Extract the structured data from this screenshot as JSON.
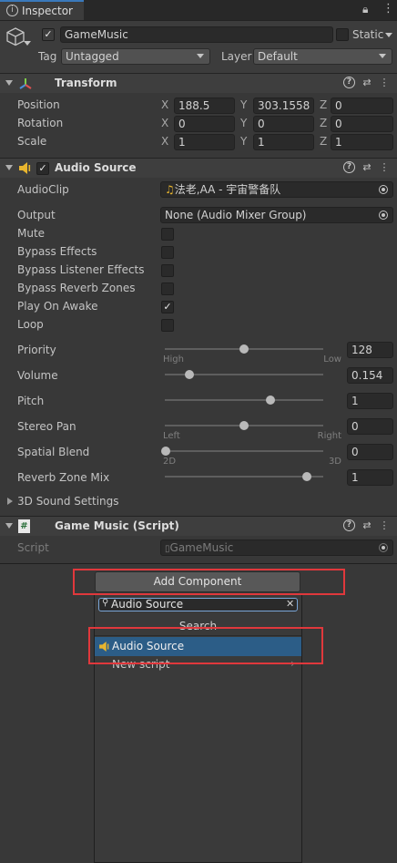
{
  "tab": {
    "title": "Inspector"
  },
  "object": {
    "name": "GameMusic",
    "static_label": "Static",
    "tag_label": "Tag",
    "tag_value": "Untagged",
    "layer_label": "Layer",
    "layer_value": "Default"
  },
  "transform": {
    "title": "Transform",
    "rows": [
      {
        "label": "Position",
        "x": "188.5",
        "y": "303.1558",
        "z": "0"
      },
      {
        "label": "Rotation",
        "x": "0",
        "y": "0",
        "z": "0"
      },
      {
        "label": "Scale",
        "x": "1",
        "y": "1",
        "z": "1"
      }
    ],
    "axis": {
      "x": "X",
      "y": "Y",
      "z": "Z"
    }
  },
  "audio": {
    "title": "Audio Source",
    "clip_label": "AudioClip",
    "clip_value": "法老,AA - 宇宙警备队",
    "output_label": "Output",
    "output_value": "None (Audio Mixer Group)",
    "toggles": [
      {
        "label": "Mute",
        "checked": false
      },
      {
        "label": "Bypass Effects",
        "checked": false
      },
      {
        "label": "Bypass Listener Effects",
        "checked": false
      },
      {
        "label": "Bypass Reverb Zones",
        "checked": false
      },
      {
        "label": "Play On Awake",
        "checked": true
      },
      {
        "label": "Loop",
        "checked": false
      }
    ],
    "sliders": [
      {
        "label": "Priority",
        "value": "128",
        "level": 0.5,
        "left": "High",
        "right": "Low"
      },
      {
        "label": "Volume",
        "value": "0.154",
        "level": 0.154
      },
      {
        "label": "Pitch",
        "value": "1",
        "level": 0.67
      },
      {
        "label": "Stereo Pan",
        "value": "0",
        "level": 0.5,
        "left": "Left",
        "right": "Right"
      },
      {
        "label": "Spatial Blend",
        "value": "0",
        "level": 0.0,
        "left": "2D",
        "right": "3D"
      },
      {
        "label": "Reverb Zone Mix",
        "value": "1",
        "level": 0.9
      }
    ],
    "sound_settings_label": "3D Sound Settings"
  },
  "script": {
    "title": "Game Music (Script)",
    "field_label": "Script",
    "field_value": "GameMusic"
  },
  "add_component": {
    "button_label": "Add Component",
    "search_value": "Audio Source",
    "section_label": "Search",
    "result_label": "Audio Source",
    "new_script_label": "New script"
  },
  "colors": {
    "accent": "#2c5d87",
    "highlight_box": "#e0383c",
    "speaker_icon": "#e8b52e"
  }
}
